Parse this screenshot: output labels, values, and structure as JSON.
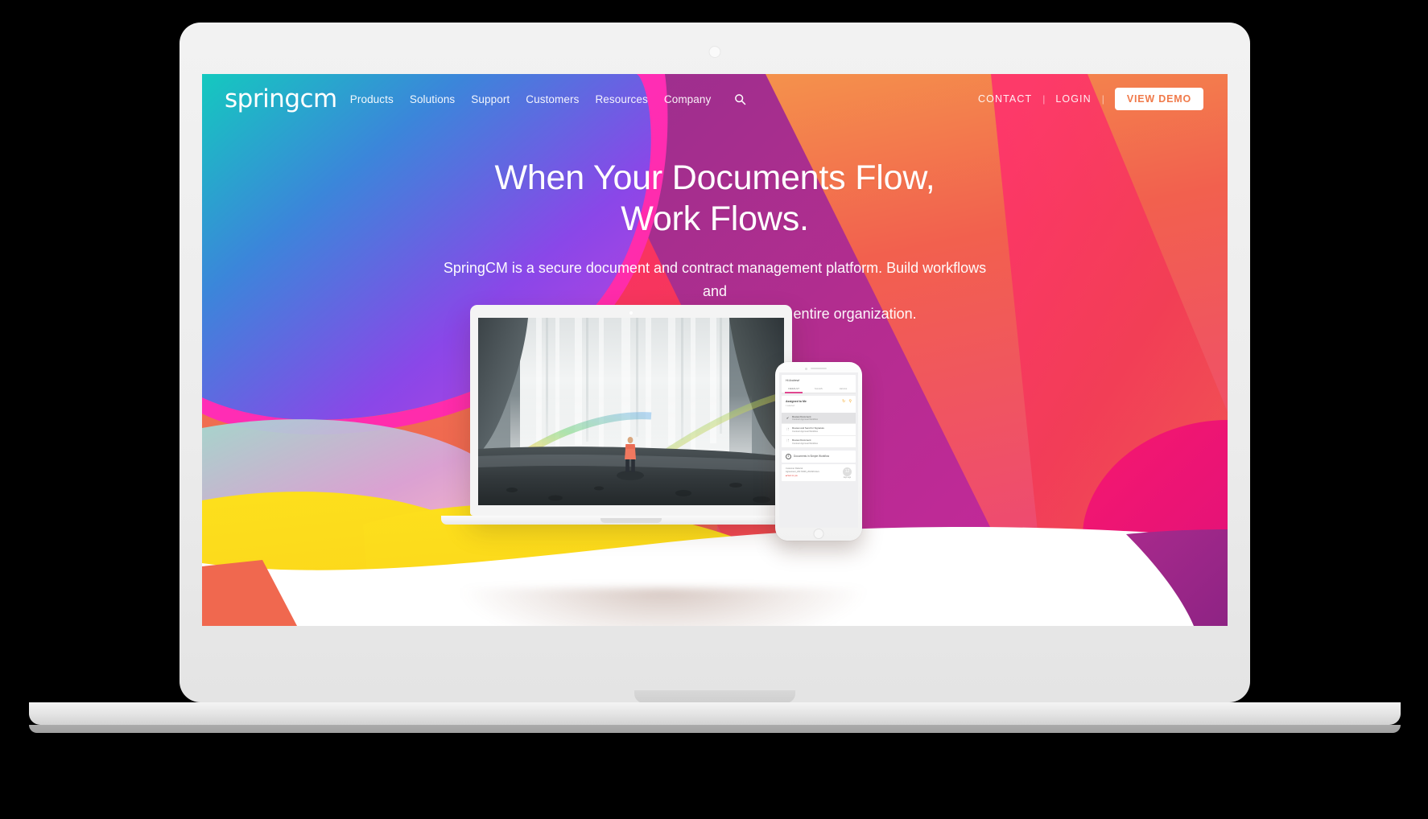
{
  "site": {
    "logo": "springcm",
    "nav_links": [
      "Products",
      "Solutions",
      "Support",
      "Customers",
      "Resources",
      "Company"
    ],
    "search_icon": "search-icon",
    "utility_links": [
      "CONTACT",
      "LOGIN"
    ],
    "separator": "|",
    "cta_label": "VIEW DEMO"
  },
  "hero": {
    "headline_line1": "When Your Documents Flow,",
    "headline_line2": "Work Flows.",
    "subhead_line1": "SpringCM is a secure document and contract management platform. Build workflows and",
    "subhead_line2": "enable document collaboration across your entire organization."
  },
  "laptop_screen_image": {
    "description": "Person in orange jacket standing on rock before a large waterfall with a rainbow"
  },
  "phone_app": {
    "greeting": "Hi Andrew!",
    "tabs": [
      {
        "label": "DEFAULT",
        "active": true
      },
      {
        "label": "SALES",
        "active": false
      },
      {
        "label": "LEGAL",
        "active": false
      }
    ],
    "section_title": "Assigned to Me",
    "section_sub": "1 selected",
    "refresh_icon": "refresh-icon",
    "search_icon": "search-icon",
    "tasks": [
      {
        "icon": "check-icon",
        "title": "Review Document",
        "workflow": "Contract Approval Workflow",
        "selected": true
      },
      {
        "icon": "document-icon",
        "title": "Review and Send for Signature",
        "workflow": "Contract Approval Workflow",
        "selected": false
      },
      {
        "icon": "document-icon",
        "title": "Review Document",
        "workflow": "Contract Approval Workflow",
        "selected": false
      }
    ],
    "workflow_count": "4",
    "workflow_label": "Documents in Simple Workflow",
    "doc": {
      "name": "Customer Referral Agreement_20170406_202420.docx",
      "status": "Sent to you",
      "days": "12",
      "days_label": "days ago"
    }
  },
  "colors": {
    "teal": "#18c8c0",
    "blue": "#3e86d8",
    "purple": "#9b46e8",
    "magenta": "#ff2fd0",
    "pink": "#ed1e79",
    "crimson": "#f0315c",
    "coral": "#f2604e",
    "orange": "#f2a04a",
    "yellow": "#fbdc1a",
    "plum": "#a52a8a",
    "white": "#ffffff"
  }
}
